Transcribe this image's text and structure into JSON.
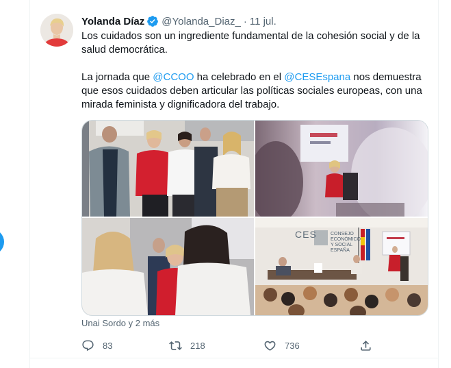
{
  "tweet": {
    "author_name": "Yolanda Díaz",
    "handle": "@Yolanda_Diaz_",
    "separator": "·",
    "date": "11 jul.",
    "paragraph1": "Los cuidados son un ingrediente fundamental de la cohesión social y de la salud democrática.",
    "p2_part1": "La jornada que ",
    "mention1": "@CCOO",
    "p2_part2": " ha celebrado en el ",
    "mention2": "@CESEspana",
    "p2_part3": " nos demuestra que esos cuidados deben articular las políticas sociales europeas, con una mirada feminista y dignificadora del trabajo.",
    "tagged_people": "Unai Sordo y 2 más"
  },
  "media": {
    "ces_logo": "CES",
    "ces_caption": [
      "CONSEJO",
      "ECONÓMICO",
      "Y SOCIAL",
      "ESPAÑA"
    ]
  },
  "actions": {
    "replies": "83",
    "retweets": "218",
    "likes": "736"
  },
  "colors": {
    "accent": "#1d9bf0",
    "secondary_text": "#536471",
    "primary_text": "#0f1419",
    "border": "#eff3f4"
  },
  "icons": [
    "verified-badge-icon",
    "reply-icon",
    "retweet-icon",
    "like-icon",
    "share-icon",
    "compose-icon"
  ]
}
